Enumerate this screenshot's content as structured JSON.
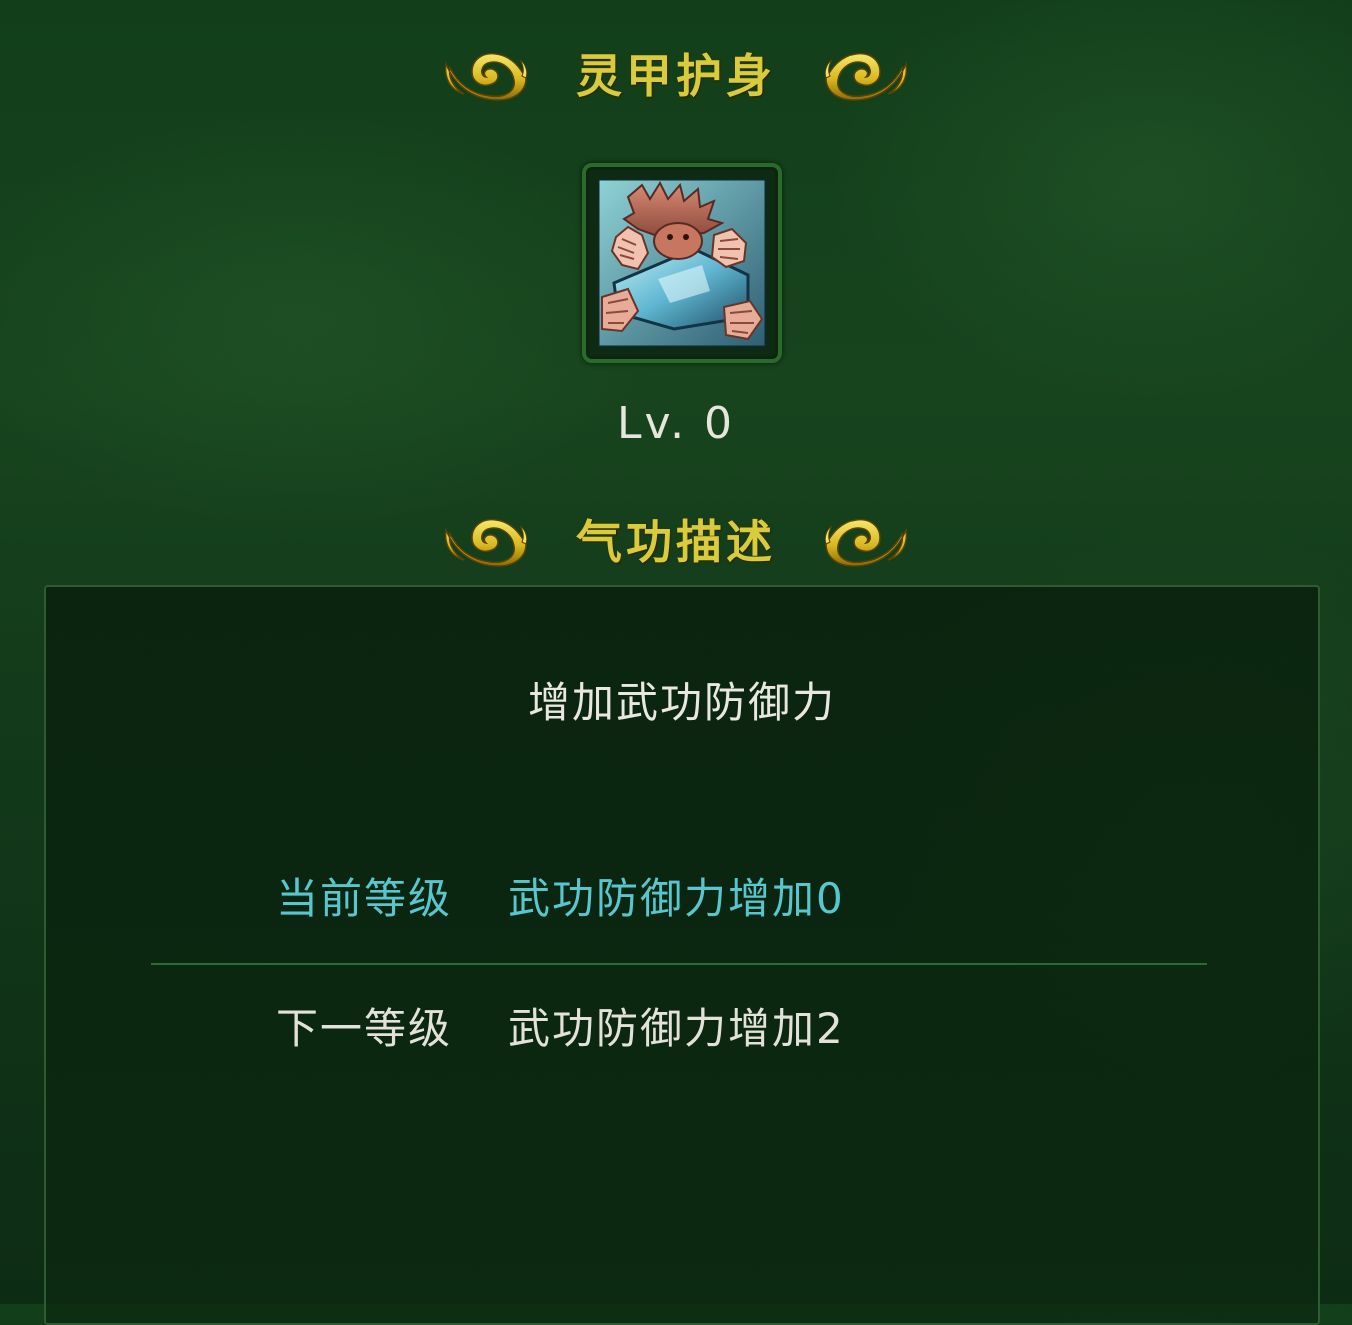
{
  "header": {
    "skill_name": "灵甲护身",
    "ornament_icon": "golden-cloud-swirl-icon"
  },
  "skill": {
    "icon": "skill-iron-palm-guard-icon",
    "level_text": "Lv. 0"
  },
  "description": {
    "section_title": "气功描述",
    "main_text": "增加武功防御力",
    "current_level": {
      "label": "当前等级",
      "value": "武功防御力增加0"
    },
    "next_level": {
      "label": "下一等级",
      "value": "武功防御力增加2"
    }
  },
  "colors": {
    "title_gold": "#d8cc3c",
    "current_cyan": "#58c6cf",
    "background_green": "#17441d"
  }
}
